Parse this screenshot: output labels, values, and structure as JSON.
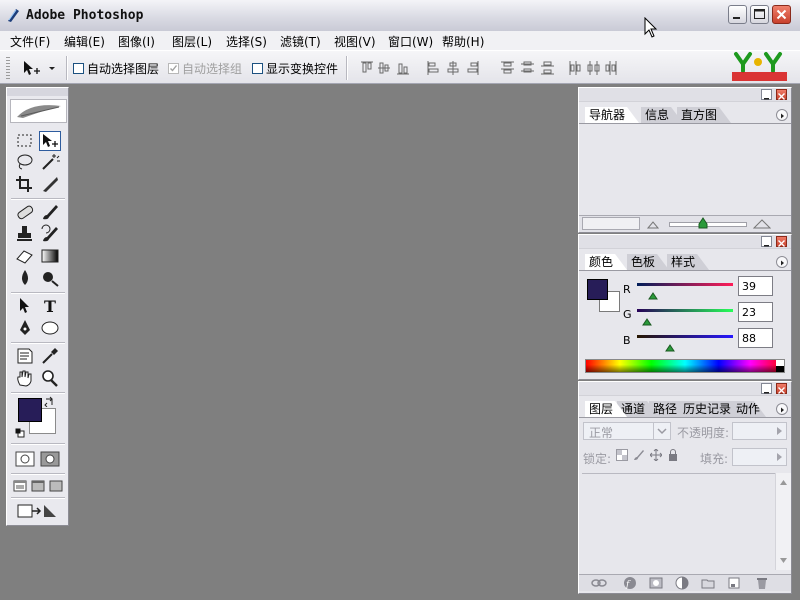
{
  "window": {
    "title": "Adobe Photoshop",
    "buttons": [
      "minimize",
      "maximize",
      "close"
    ]
  },
  "menubar": {
    "items": [
      "文件(F)",
      "编辑(E)",
      "图像(I)",
      "图层(L)",
      "选择(S)",
      "滤镜(T)",
      "视图(V)",
      "窗口(W)",
      "帮助(H)"
    ]
  },
  "options": {
    "auto_select_layer": "自动选择图层",
    "auto_select_group": "自动选择组",
    "show_transform": "显示变换控件"
  },
  "navigator_panel": {
    "tabs": [
      "导航器",
      "信息",
      "直方图"
    ],
    "zoom_level": 0.45
  },
  "color_panel": {
    "tabs": [
      "颜色",
      "色板",
      "样式"
    ],
    "r_label": "R",
    "g_label": "G",
    "b_label": "B",
    "r_value": "39",
    "g_value": "23",
    "b_value": "88",
    "foreground_color": "#271d58",
    "background_color": "#ffffff"
  },
  "layers_panel": {
    "tabs": [
      "图层",
      "通道",
      "路径",
      "历史记录",
      "动作"
    ],
    "blend_mode": "正常",
    "opacity_label": "不透明度:",
    "lock_label": "锁定:",
    "fill_label": "填充:"
  },
  "colors": {
    "workspace": "#7f7f7f",
    "panel": "#e7e7ec",
    "accent": "#2e5c9e"
  }
}
